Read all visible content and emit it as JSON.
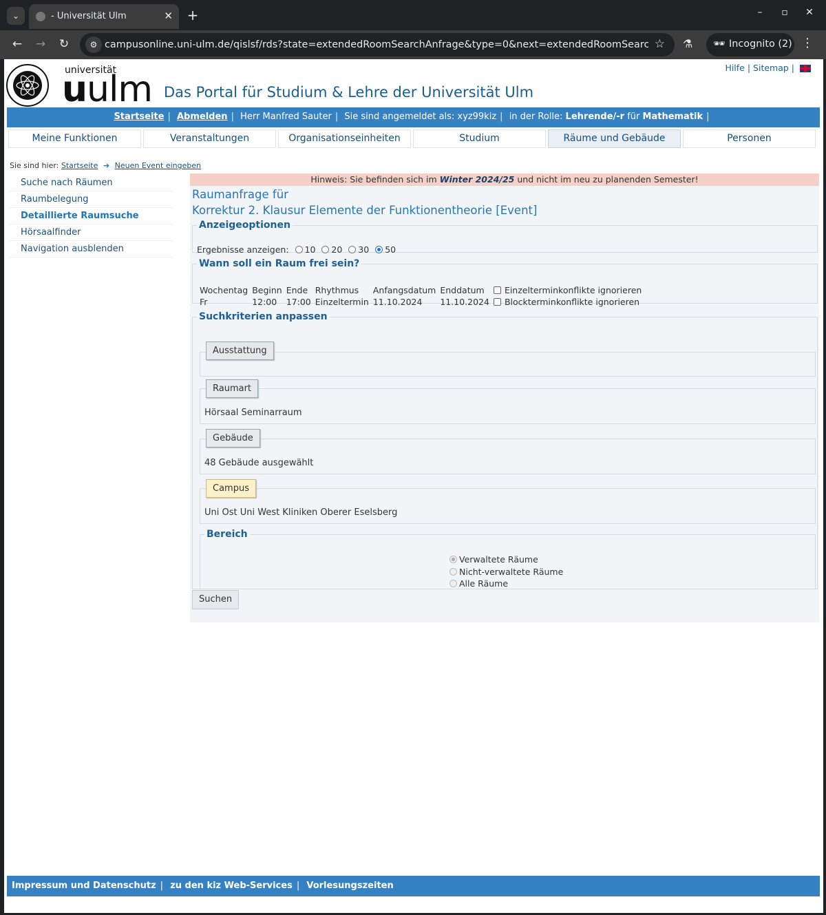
{
  "browser": {
    "tab_title": "- Universität Ulm",
    "url": "campusonline.uni-ulm.de/qislsf/rds?state=extendedRoomSearchAnfrage&type=0&next=extendedRoomSearch.vm&...",
    "incognito_label": "Incognito (2)"
  },
  "header": {
    "uni_word": "universität",
    "ulm_word": "ulm",
    "portal_title": "Das Portal für Studium & Lehre der Universität Ulm",
    "help": "Hilfe",
    "sitemap": "Sitemap"
  },
  "userbar": {
    "home": "Startseite",
    "logout": "Abmelden",
    "user": "Herr Manfred Sauter",
    "logged_in_as": "Sie sind angemeldet als: xyz99kiz",
    "role_prefix": "in der Rolle:",
    "role": "Lehrende/-r",
    "role_for": "für",
    "dept": "Mathematik"
  },
  "mainnav": {
    "tabs": [
      "Meine Funktionen",
      "Veranstaltungen",
      "Organisationseinheiten",
      "Studium",
      "Räume und Gebäude",
      "Personen"
    ],
    "active_index": 4
  },
  "breadcrumb": {
    "prefix": "Sie sind hier:",
    "home": "Startseite",
    "current": "Neuen Event eingeben"
  },
  "sidebar": {
    "items": [
      "Suche nach Räumen",
      "Raumbelegung",
      "Detaillierte Raumsuche",
      "Hörsaalfinder",
      "Navigation ausblenden"
    ],
    "active_index": 2
  },
  "notice": {
    "prefix": "Hinweis: Sie befinden sich im",
    "semester": "Winter 2024/25",
    "suffix": "und nicht im neu zu planenden Semester!"
  },
  "request": {
    "line1": "Raumanfrage für",
    "line2": "Korrektur 2. Klausur Elemente der Funktionentheorie [Event]"
  },
  "display_options": {
    "legend": "Anzeigeoptionen",
    "label": "Ergebnisse anzeigen:",
    "options": [
      "10",
      "20",
      "30",
      "50"
    ],
    "selected": "50"
  },
  "when": {
    "legend": "Wann soll ein Raum frei sein?",
    "headers": [
      "Wochentag",
      "Beginn",
      "Ende",
      "Rhythmus",
      "Anfangsdatum",
      "Enddatum"
    ],
    "row": [
      "Fr",
      "12:00",
      "17:00",
      "Einzeltermin",
      "11.10.2024",
      "11.10.2024"
    ],
    "check1": "Einzelterminkonflikte ignorieren",
    "check2": "Blockterminkonflikte ignorieren"
  },
  "criteria": {
    "legend": "Suchkriterien anpassen",
    "ausstattung": "Ausstattung",
    "raumart": "Raumart",
    "raumart_value": "Hörsaal Seminarraum",
    "gebaeude": "Gebäude",
    "gebaeude_value": "48 Gebäude ausgewählt",
    "campus": "Campus",
    "campus_value": "Uni Ost Uni West Kliniken Oberer Eselsberg",
    "bereich_legend": "Bereich",
    "bereich_options": [
      "Verwaltete Räume",
      "Nicht-verwaltete Räume",
      "Alle Räume"
    ],
    "submit": "Suchen"
  },
  "footer": {
    "links": [
      "Impressum und Datenschutz",
      "zu den kiz Web-Services",
      "Vorlesungszeiten"
    ]
  },
  "colors": {
    "blue_bar": "#3681c2",
    "notice_bg": "#f5d0c6",
    "campus_highlight": "#fdf1c7"
  }
}
